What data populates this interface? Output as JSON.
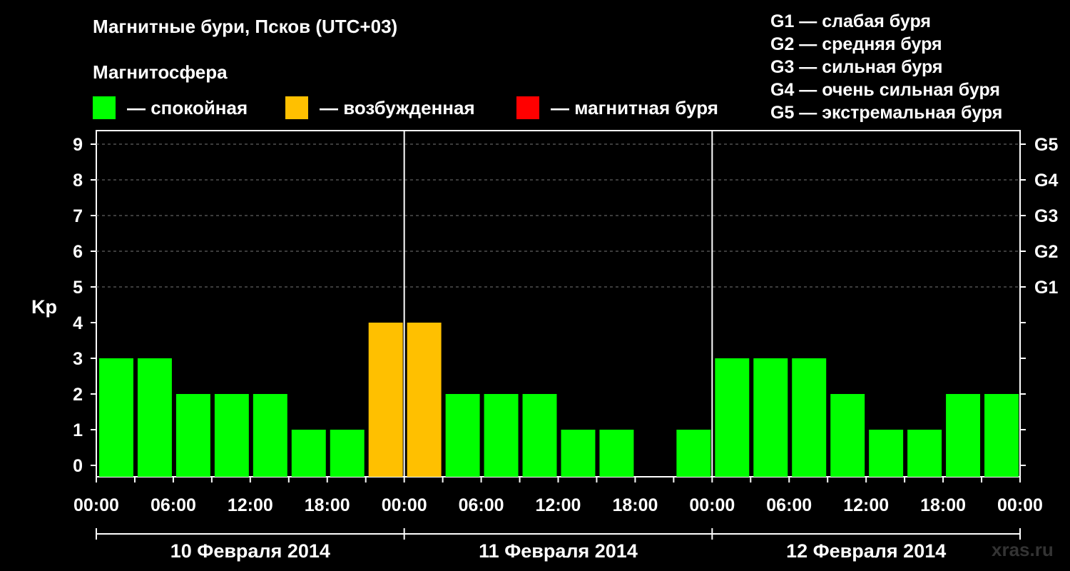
{
  "title": "Магнитные бури, Псков (UTC+03)",
  "subtitle": "Магнитосфера",
  "legend": [
    {
      "color": "#00ff00",
      "label": "— спокойная"
    },
    {
      "color": "#ffc000",
      "label": "— возбужденная"
    },
    {
      "color": "#ff0000",
      "label": "— магнитная буря"
    }
  ],
  "g_legend": [
    "G1 — слабая буря",
    "G2 — средняя буря",
    "G3 — сильная буря",
    "G4 — очень сильная буря",
    "G5 — экстремальная буря"
  ],
  "watermark": "xras.ru",
  "chart_data": {
    "type": "bar",
    "ylabel": "Kp",
    "ylim": [
      0,
      9
    ],
    "y_ticks": [
      "0",
      "1",
      "2",
      "3",
      "4",
      "5",
      "6",
      "7",
      "8",
      "9"
    ],
    "right_ticks": [
      {
        "value": 5,
        "label": "G1"
      },
      {
        "value": 6,
        "label": "G2"
      },
      {
        "value": 7,
        "label": "G3"
      },
      {
        "value": 8,
        "label": "G4"
      },
      {
        "value": 9,
        "label": "G5"
      }
    ],
    "x_ticks": [
      "00:00",
      "06:00",
      "12:00",
      "18:00",
      "00:00",
      "06:00",
      "12:00",
      "18:00",
      "00:00",
      "06:00",
      "12:00",
      "18:00",
      "00:00"
    ],
    "days": [
      "10 Февраля 2014",
      "11 Февраля 2014",
      "12 Февраля 2014"
    ],
    "interval_hours": 3,
    "values": [
      3,
      3,
      2,
      2,
      2,
      1,
      1,
      4,
      4,
      2,
      2,
      2,
      1,
      1,
      0,
      1,
      3,
      3,
      3,
      2,
      1,
      1,
      2,
      2
    ],
    "colors": {
      "quiet": "#00ff00",
      "active": "#ffc000",
      "storm": "#ff0000"
    },
    "grid": "dashed at Kp 5-9"
  }
}
